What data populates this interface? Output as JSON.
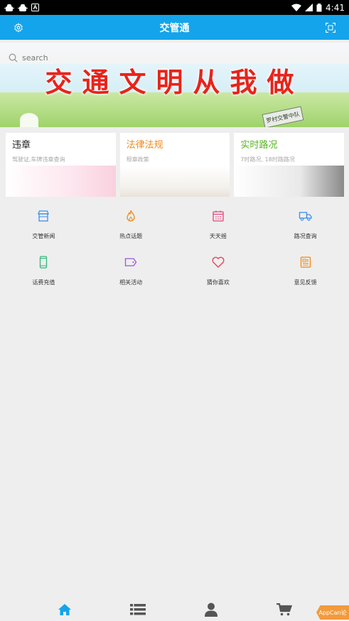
{
  "status_bar": {
    "left_icons": [
      "android-bug-icon",
      "android-bug-icon",
      "notification-a-icon"
    ],
    "time": "4:41"
  },
  "app_bar": {
    "title": "交管通"
  },
  "search": {
    "placeholder": "search"
  },
  "banner": {
    "slogan": "交通文明从我做",
    "sign_text": "罗村交警中队"
  },
  "cards": [
    {
      "title": "违章",
      "subtitle": "驾驶证,车牌违章查询"
    },
    {
      "title": "法律法规",
      "subtitle": "规章政策"
    },
    {
      "title": "实时路况",
      "subtitle": "7时路况, 18时路路况"
    }
  ],
  "grid": [
    {
      "label": "交管新闻",
      "icon": "store-icon",
      "color": "#3d8ee8"
    },
    {
      "label": "热点话题",
      "icon": "fire-icon",
      "color": "#f0891b"
    },
    {
      "label": "天天摇",
      "icon": "calendar-icon",
      "color": "#e8447a"
    },
    {
      "label": "路况查询",
      "icon": "truck-icon",
      "color": "#3d8ee8"
    },
    {
      "label": "话费充值",
      "icon": "phone-icon",
      "color": "#2fb87a"
    },
    {
      "label": "相关活动",
      "icon": "tag-icon",
      "color": "#9a55d6"
    },
    {
      "label": "猜你喜欢",
      "icon": "heart-icon",
      "color": "#e8445a"
    },
    {
      "label": "意见反馈",
      "icon": "newspaper-icon",
      "color": "#f0891b"
    }
  ],
  "bottom_nav": [
    {
      "name": "home-icon",
      "active": true
    },
    {
      "name": "list-icon",
      "active": false
    },
    {
      "name": "user-icon",
      "active": false
    },
    {
      "name": "cart-icon",
      "active": false
    }
  ],
  "badge": {
    "label": "AppCan论"
  },
  "colors": {
    "primary": "#14a4eb",
    "accent_orange": "#f0891b",
    "accent_green": "#57b520",
    "nav_icon": "#555555",
    "nav_active": "#14a4eb"
  }
}
